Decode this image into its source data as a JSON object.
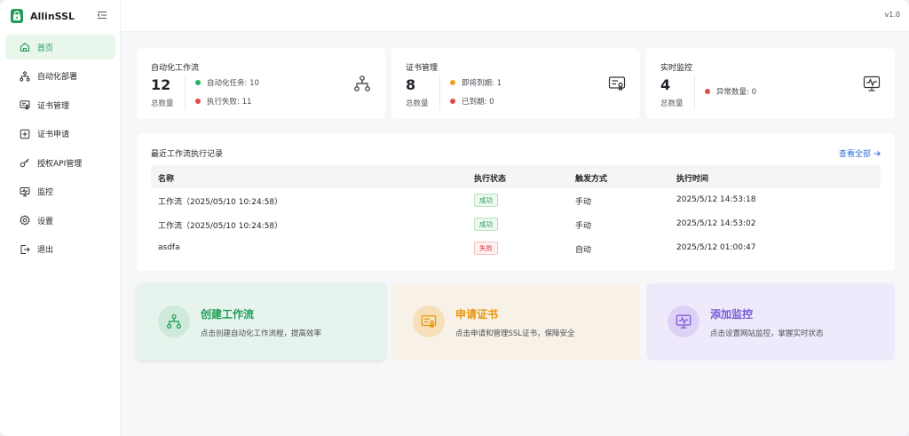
{
  "app": {
    "name": "AllinSSL",
    "version": "v1.0",
    "brand_color": "#1f9d55"
  },
  "sidebar": {
    "items": [
      {
        "label": "首页",
        "icon": "home-icon",
        "active": true
      },
      {
        "label": "自动化部署",
        "icon": "workflow-icon",
        "active": false
      },
      {
        "label": "证书管理",
        "icon": "certificate-icon",
        "active": false
      },
      {
        "label": "证书申请",
        "icon": "plus-square-icon",
        "active": false
      },
      {
        "label": "授权API管理",
        "icon": "key-icon",
        "active": false
      },
      {
        "label": "监控",
        "icon": "monitor-icon",
        "active": false
      },
      {
        "label": "设置",
        "icon": "gear-icon",
        "active": false
      },
      {
        "label": "退出",
        "icon": "logout-icon",
        "active": false
      }
    ]
  },
  "stats": {
    "workflow": {
      "title": "自动化工作流",
      "count": "12",
      "sub": "总数量",
      "lines": [
        {
          "text": "自动化任务: 10",
          "color": "#22b35e"
        },
        {
          "text": "执行失败: 11",
          "color": "#e5484d"
        }
      ]
    },
    "certs": {
      "title": "证书管理",
      "count": "8",
      "sub": "总数量",
      "lines": [
        {
          "text": "即将到期: 1",
          "color": "#f0a020"
        },
        {
          "text": "已到期: 0",
          "color": "#e5484d"
        }
      ]
    },
    "monitor": {
      "title": "实时监控",
      "count": "4",
      "sub": "总数量",
      "lines": [
        {
          "text": "异常数量: 0",
          "color": "#e5484d"
        }
      ]
    }
  },
  "records": {
    "title": "最近工作流执行记录",
    "view_all": "查看全部",
    "columns": [
      "名称",
      "执行状态",
      "触发方式",
      "执行时间"
    ],
    "rows": [
      {
        "name": "工作流（2025/05/10 10:24:58）",
        "status": "成功",
        "status_type": "ok",
        "trigger": "手动",
        "time": "2025/5/12 14:53:18"
      },
      {
        "name": "工作流（2025/05/10 10:24:58）",
        "status": "成功",
        "status_type": "ok",
        "trigger": "手动",
        "time": "2025/5/12 14:53:02"
      },
      {
        "name": "asdfa",
        "status": "失败",
        "status_type": "fail",
        "trigger": "自动",
        "time": "2025/5/12 01:00:47"
      }
    ]
  },
  "actions": {
    "workflow": {
      "title": "创建工作流",
      "desc": "点击创建自动化工作流程，提高效率",
      "color": "#1f9d55"
    },
    "apply": {
      "title": "申请证书",
      "desc": "点击申请和管理SSL证书，保障安全",
      "color": "#e8960c"
    },
    "monitor": {
      "title": "添加监控",
      "desc": "点击设置网站监控，掌握实时状态",
      "color": "#7b5cd6"
    }
  }
}
